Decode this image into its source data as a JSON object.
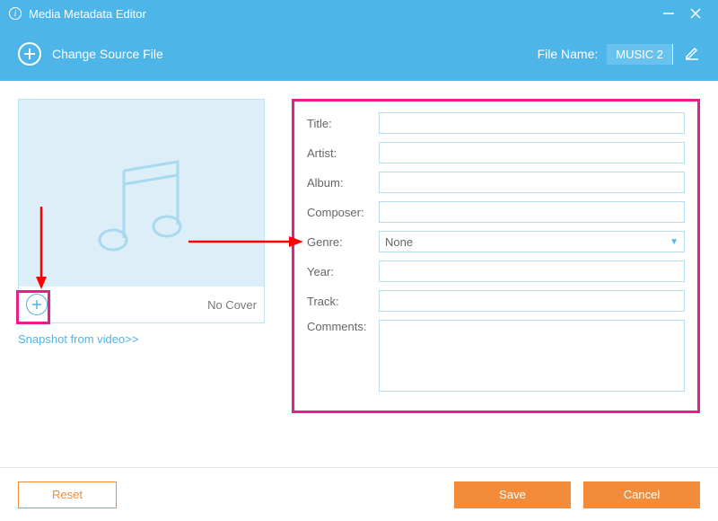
{
  "window": {
    "title": "Media Metadata Editor"
  },
  "toolbar": {
    "change_source": "Change Source File",
    "filename_label": "File Name:",
    "filename_value": "MUSIC 2"
  },
  "cover": {
    "no_cover": "No Cover",
    "snapshot_link": "Snapshot from video>>"
  },
  "form": {
    "title_label": "Title:",
    "artist_label": "Artist:",
    "album_label": "Album:",
    "composer_label": "Composer:",
    "genre_label": "Genre:",
    "genre_value": "None",
    "year_label": "Year:",
    "track_label": "Track:",
    "comments_label": "Comments:",
    "title_value": "",
    "artist_value": "",
    "album_value": "",
    "composer_value": "",
    "year_value": "",
    "track_value": "",
    "comments_value": ""
  },
  "footer": {
    "reset": "Reset",
    "save": "Save",
    "cancel": "Cancel"
  }
}
